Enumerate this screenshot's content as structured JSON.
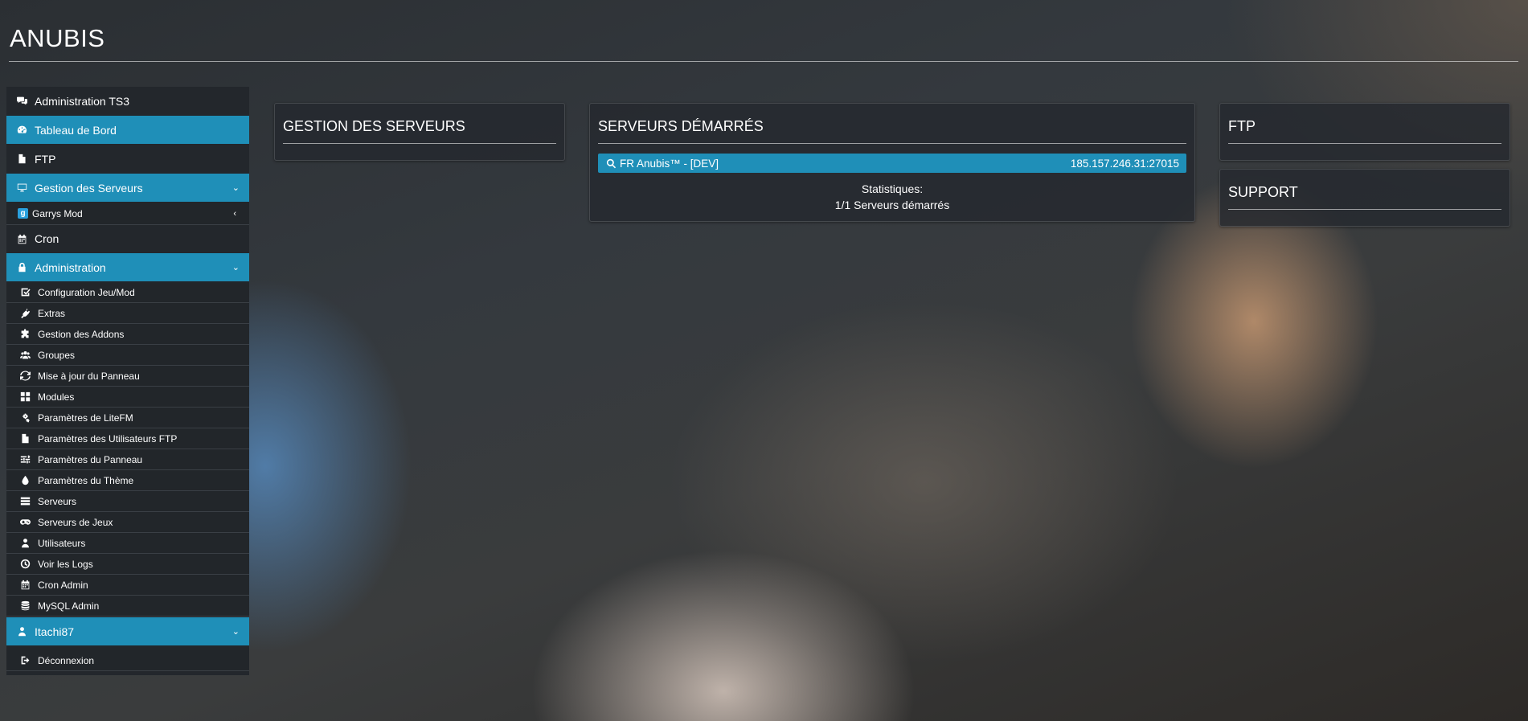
{
  "brand": "ANUBIS",
  "sidebar": {
    "ts3": "Administration TS3",
    "dashboard": "Tableau de Bord",
    "ftp": "FTP",
    "server_mgmt": "Gestion des Serveurs",
    "gmod_badge": "g",
    "gmod": "Garrys Mod",
    "cron": "Cron",
    "admin": "Administration",
    "admin_items": [
      "Configuration Jeu/Mod",
      "Extras",
      "Gestion des Addons",
      "Groupes",
      "Mise à jour du Panneau",
      "Modules",
      "Paramètres de LiteFM",
      "Paramètres des Utilisateurs FTP",
      "Paramètres du Panneau",
      "Paramètres du Thème",
      "Serveurs",
      "Serveurs de Jeux",
      "Utilisateurs",
      "Voir les Logs",
      "Cron Admin",
      "MySQL Admin"
    ],
    "user": "Itachi87",
    "logout": "Déconnexion"
  },
  "panels": {
    "gestion_title": "GESTION DES SERVEURS",
    "started_title": "SERVEURS DÉMARRÉS",
    "server_name": "FR Anubis™ - [DEV]",
    "server_ip": "185.157.246.31:27015",
    "stats_label": "Statistiques:",
    "stats_value": "1/1 Serveurs démarrés",
    "ftp_title": "FTP",
    "support_title": "SUPPORT"
  },
  "colors": {
    "accent": "#1f8fb8",
    "sidebar_bg": "#23272c"
  }
}
